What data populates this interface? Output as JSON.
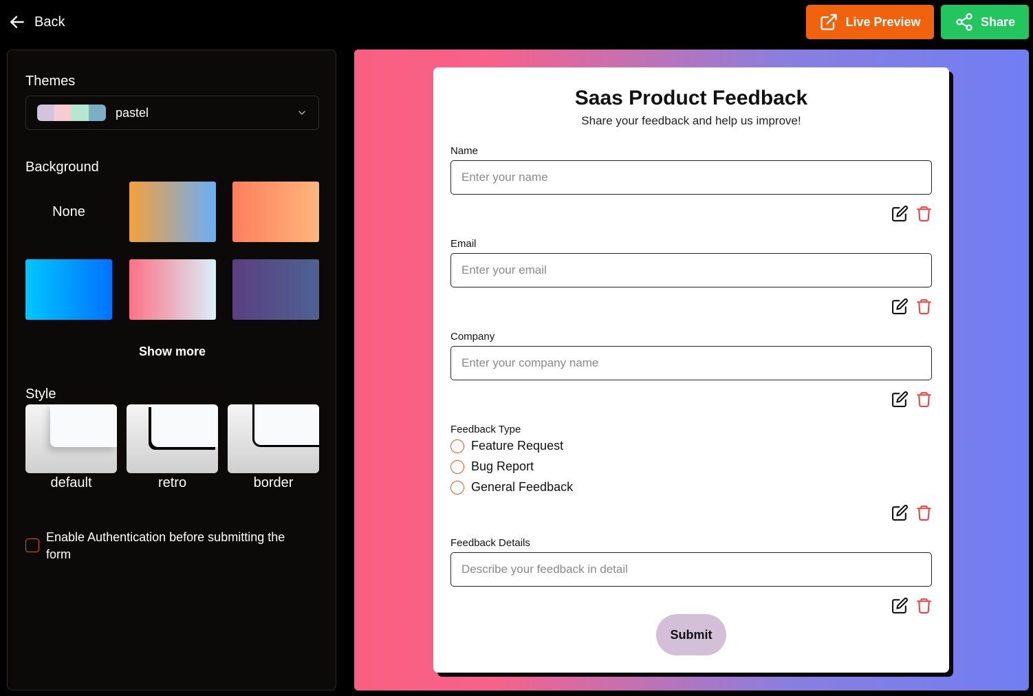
{
  "header": {
    "back_label": "Back",
    "live_preview_label": "Live Preview",
    "share_label": "Share",
    "live_preview_color": "#f0620c",
    "share_color": "#22c55e"
  },
  "sidebar": {
    "themes_title": "Themes",
    "theme_selected": "pastel",
    "theme_swatches": [
      "#d4c3dc",
      "#f6cbd3",
      "#b5e6d4",
      "#7eaec6"
    ],
    "background_title": "Background",
    "background_none_label": "None",
    "background_gradients": [
      "linear-gradient(90deg, #f3a13a, #6aaef7)",
      "linear-gradient(90deg, #fe7f5e, #feb57b)",
      "linear-gradient(90deg, #00c6ff, #0072ff)",
      "linear-gradient(90deg, #fb7185, #d9f0fa)",
      "linear-gradient(90deg, #5a3f7f, #4e6292)"
    ],
    "show_more_label": "Show more",
    "style_title": "Style",
    "styles": [
      "default",
      "retro",
      "border"
    ],
    "auth_label": "Enable Authentication before submitting the form",
    "auth_checked": false
  },
  "form": {
    "title": "Saas Product Feedback",
    "subtitle": "Share your feedback and help us improve!",
    "name_label": "Name",
    "name_placeholder": "Enter your name",
    "email_label": "Email",
    "email_placeholder": "Enter your email",
    "company_label": "Company",
    "company_placeholder": "Enter your company name",
    "feedback_type_label": "Feedback Type",
    "feedback_options": [
      "Feature Request",
      "Bug Report",
      "General Feedback"
    ],
    "details_label": "Feedback Details",
    "details_placeholder": "Describe your feedback in detail",
    "submit_label": "Submit"
  }
}
